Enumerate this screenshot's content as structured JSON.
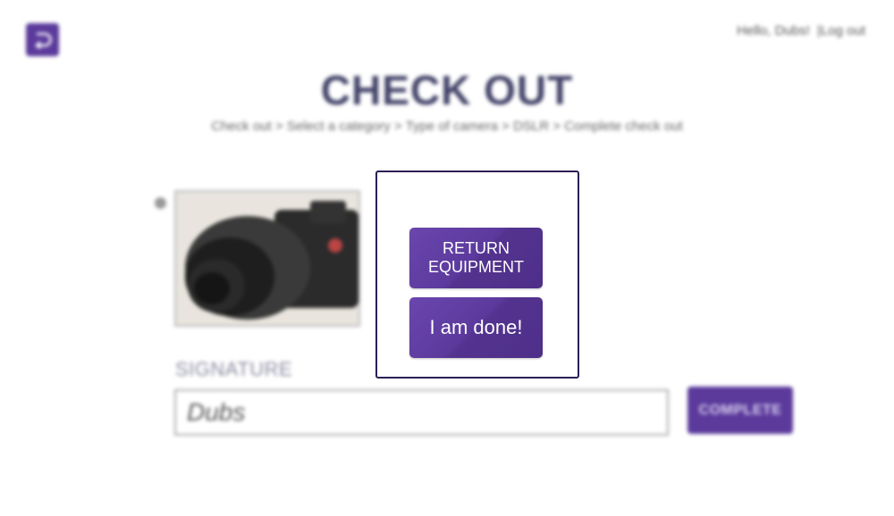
{
  "header": {
    "greeting": "Hello, Dubs!",
    "separator": "|",
    "logout_label": "Log out"
  },
  "page": {
    "title": "CHECK OUT",
    "breadcrumb": "Check out > Select a category > Type of camera > DSLR > Complete check out"
  },
  "signature": {
    "label": "SIGNATURE",
    "value": "Dubs",
    "complete_label": "COMPLETE"
  },
  "modal": {
    "return_label": "RETURN EQUIPMENT",
    "done_label": "I am done!"
  },
  "colors": {
    "accent": "#5b3a9b",
    "modal_border": "#2c1f55"
  }
}
